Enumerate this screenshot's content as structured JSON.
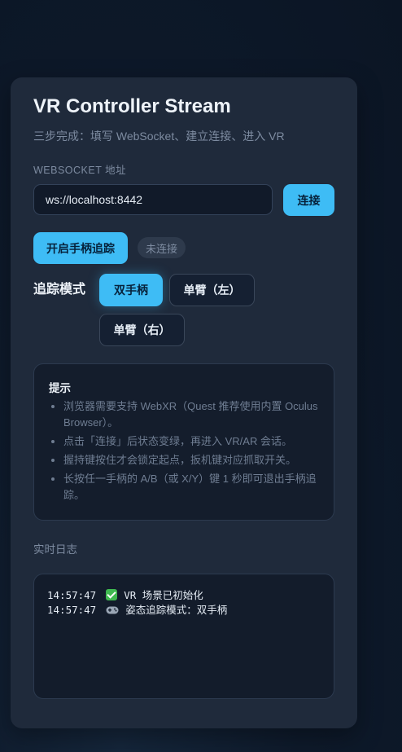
{
  "header": {
    "title": "VR Controller Stream",
    "subtitle": "三步完成：填写 WebSocket、建立连接、进入 VR"
  },
  "connection": {
    "websocket_label": "WEBSOCKET 地址",
    "websocket_value": "ws://localhost:8442",
    "connect_label": "连接"
  },
  "tracking": {
    "start_label": "开启手柄追踪",
    "status_text": "未连接"
  },
  "mode": {
    "label": "追踪模式",
    "options": [
      {
        "label": "双手柄",
        "active": true
      },
      {
        "label": "单臂（左）",
        "active": false
      },
      {
        "label": "单臂（右）",
        "active": false
      }
    ]
  },
  "tips": {
    "title": "提示",
    "items": [
      "浏览器需要支持 WebXR（Quest 推荐使用内置 Oculus Browser）。",
      "点击「连接」后状态变绿，再进入 VR/AR 会话。",
      "握持键按住才会锁定起点，扳机键对应抓取开关。",
      "长按任一手柄的 A/B（或 X/Y）键 1 秒即可退出手柄追踪。"
    ]
  },
  "log": {
    "label": "实时日志",
    "entries": [
      {
        "time": "14:57:47",
        "icon": "check-icon",
        "text": "VR 场景已初始化"
      },
      {
        "time": "14:57:47",
        "icon": "gamepad-icon",
        "text": "姿态追踪模式：双手柄"
      }
    ]
  },
  "colors": {
    "accent": "#3ebcf5",
    "card_bg": "#1f2a3b",
    "page_bg": "#0e1a2b"
  }
}
